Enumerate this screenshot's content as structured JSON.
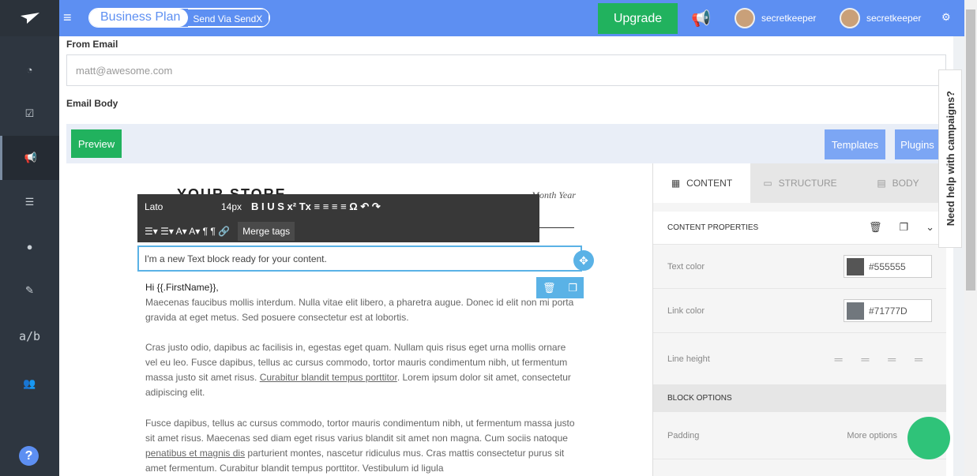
{
  "app": {
    "plan_label": "Business Plan",
    "send_label": "Send Via SendX",
    "upgrade_label": "Upgrade",
    "user1": "secretkeeper",
    "user2": "secretkeeper"
  },
  "sidebar": {
    "items": [
      {
        "icon": "dashboard-icon"
      },
      {
        "icon": "checklist-icon"
      },
      {
        "icon": "megaphone-icon"
      },
      {
        "icon": "list-icon"
      },
      {
        "icon": "drop-icon"
      },
      {
        "icon": "magic-wand-icon"
      },
      {
        "label": "a/b"
      },
      {
        "icon": "users-icon"
      }
    ],
    "help_label": "?"
  },
  "form": {
    "from_label": "From Email",
    "from_placeholder": "matt@awesome.com",
    "body_label": "Email Body"
  },
  "editor": {
    "preview_label": "Preview",
    "templates_label": "Templates",
    "plugins_label": "Plugins",
    "help_label": "Need help with campaigns?"
  },
  "canvas": {
    "store_title": "YOUR STORE",
    "date": "Month Year",
    "new_block": "I'm a new Text block ready for your content.",
    "greeting": "Hi {{.FirstName}},",
    "para1": "Maecenas faucibus mollis interdum. Nulla vitae elit libero, a pharetra augue. Donec id elit non mi porta gravida at eget metus. Sed posuere consectetur est at lobortis.",
    "para2a": "Cras justo odio, dapibus ac facilisis in, egestas eget quam. Nullam quis risus eget urna mollis ornare vel eu leo. Fusce dapibus, tellus ac cursus commodo, tortor mauris condimentum nibh, ut fermentum massa justo sit amet risus.",
    "para2_link": "Curabitur blandit tempus porttitor",
    "para2b": ". Lorem ipsum dolor sit amet, consectetur adipiscing elit.",
    "para3a": "Fusce dapibus, tellus ac cursus commodo, tortor mauris condimentum nibh, ut fermentum massa justo sit amet risus. Maecenas sed diam eget risus varius blandit sit amet non magna. Cum sociis natoque",
    "para3_link": "penatibus et magnis dis",
    "para3b": "parturient montes, nascetur ridiculus mus. Cras mattis consectetur purus sit amet fermentum. Curabitur blandit tempus porttitor. Vestibulum id ligula"
  },
  "rte": {
    "font": "Lato",
    "size": "14px",
    "merge_tags": "Merge tags"
  },
  "panel": {
    "tabs": [
      "CONTENT",
      "STRUCTURE",
      "BODY"
    ],
    "content_props": "CONTENT PROPERTIES",
    "text_color_label": "Text color",
    "text_color": "#555555",
    "link_color_label": "Link color",
    "link_color": "#71777D",
    "line_height_label": "Line height",
    "block_options": "BLOCK OPTIONS",
    "padding_label": "Padding",
    "more_options": "More options"
  }
}
